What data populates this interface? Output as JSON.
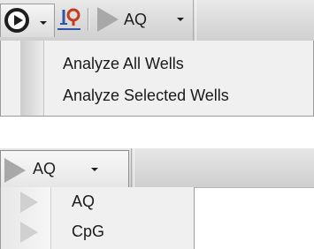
{
  "toolbar": {
    "run_button": {
      "icon": "run-circle-icon"
    },
    "well_button": {
      "icon": "well-plate-icon"
    },
    "assay_dropdown": {
      "label": "AQ",
      "icon": "play-triangle-icon"
    }
  },
  "analyze_menu": {
    "items": [
      {
        "label": "Analyze All Wells"
      },
      {
        "label": "Analyze Selected Wells"
      }
    ]
  },
  "assay_selector": {
    "label": "AQ",
    "icon": "play-triangle-icon",
    "options": [
      {
        "label": "AQ",
        "icon": "play-triangle-icon"
      },
      {
        "label": "CpG",
        "icon": "play-triangle-icon"
      }
    ]
  },
  "colors": {
    "toolbar_bg": "#d9d9d9",
    "menu_bg": "#f0f0f0",
    "icon_dark": "#1e1e1e",
    "icon_gray": "#a8a8a8",
    "well_icon_red": "#c43a1a",
    "well_icon_blue": "#2f55a8"
  }
}
